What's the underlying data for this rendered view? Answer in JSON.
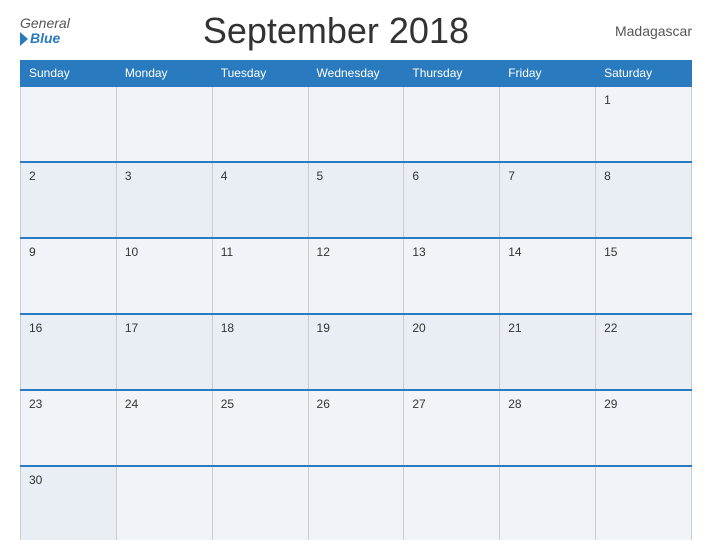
{
  "header": {
    "logo_general": "General",
    "logo_blue": "Blue",
    "title": "September 2018",
    "country": "Madagascar"
  },
  "calendar": {
    "days_of_week": [
      "Sunday",
      "Monday",
      "Tuesday",
      "Wednesday",
      "Thursday",
      "Friday",
      "Saturday"
    ],
    "weeks": [
      [
        "",
        "",
        "",
        "",
        "",
        "",
        "1"
      ],
      [
        "2",
        "3",
        "4",
        "5",
        "6",
        "7",
        "8"
      ],
      [
        "9",
        "10",
        "11",
        "12",
        "13",
        "14",
        "15"
      ],
      [
        "16",
        "17",
        "18",
        "19",
        "20",
        "21",
        "22"
      ],
      [
        "23",
        "24",
        "25",
        "26",
        "27",
        "28",
        "29"
      ],
      [
        "30",
        "",
        "",
        "",
        "",
        "",
        ""
      ]
    ]
  }
}
